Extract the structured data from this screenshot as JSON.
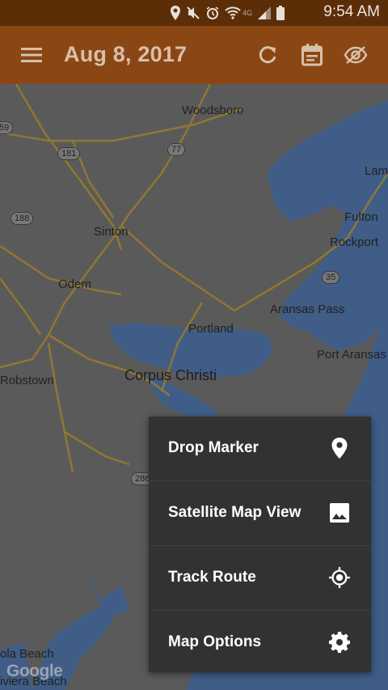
{
  "status_bar": {
    "time": "9:54 AM",
    "network": "4G"
  },
  "app_bar": {
    "date": "Aug 8, 2017",
    "icons": [
      "menu-icon",
      "refresh-icon",
      "calendar-icon",
      "visibility-icon"
    ]
  },
  "map": {
    "labels": {
      "woodsboro": "Woodsboro",
      "lam": "Lam",
      "fulton": "Fulton",
      "rockport": "Rockport",
      "sinton": "Sinton",
      "odem": "Odem",
      "aransas_pass": "Aransas Pass",
      "portland": "Portland",
      "port_aransas": "Port Aransas",
      "robstown": "Robstown",
      "corpus_christi": "Corpus Christi",
      "ola_beach": "ola Beach",
      "riviera_beach": "iviera Beach"
    },
    "shields": {
      "s59": "59",
      "s181": "181",
      "s77": "77",
      "s188": "188",
      "s35": "35",
      "s286": "286"
    },
    "attribution": "Google"
  },
  "menu": {
    "items": [
      {
        "label": "Drop Marker",
        "icon": "location-pin-icon"
      },
      {
        "label": "Satellite Map View",
        "icon": "image-icon"
      },
      {
        "label": "Track Route",
        "icon": "gps-target-icon"
      },
      {
        "label": "Map Options",
        "icon": "gear-icon"
      }
    ]
  },
  "colors": {
    "status_bar": "#5c2e08",
    "app_bar": "#8a4714",
    "menu_bg": "#323232",
    "water": "#3f5d86",
    "land": "#5a5a5a"
  }
}
